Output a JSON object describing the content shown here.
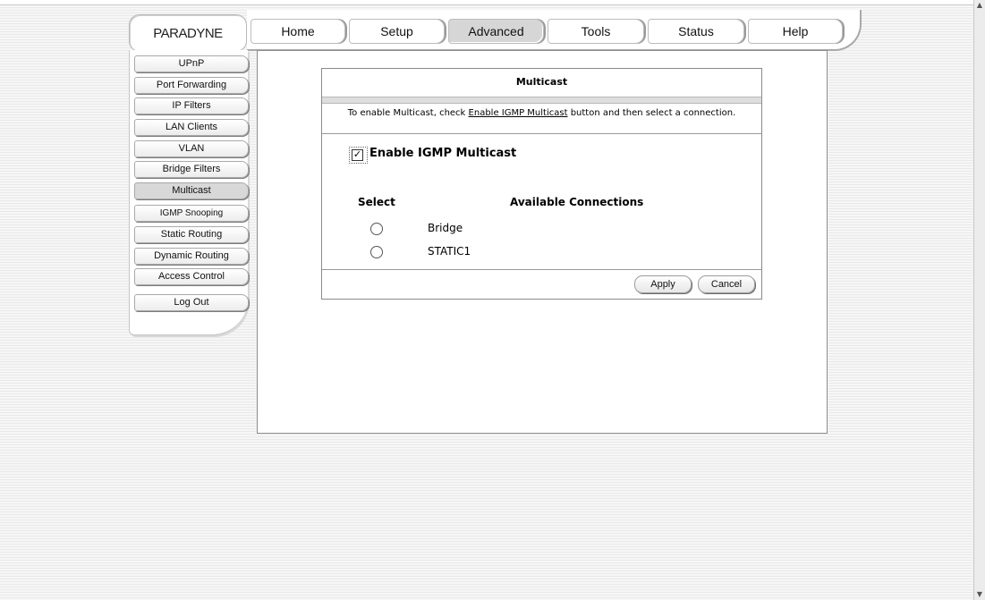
{
  "brand": {
    "logo": "PARADYNE"
  },
  "nav": {
    "tabs": [
      {
        "label": "Home"
      },
      {
        "label": "Setup"
      },
      {
        "label": "Advanced"
      },
      {
        "label": "Tools"
      },
      {
        "label": "Status"
      },
      {
        "label": "Help"
      }
    ],
    "active": "Advanced"
  },
  "sidebar": {
    "items": [
      {
        "label": "UPnP"
      },
      {
        "label": "Port Forwarding"
      },
      {
        "label": "IP Filters"
      },
      {
        "label": "LAN Clients"
      },
      {
        "label": "VLAN"
      },
      {
        "label": "Bridge Filters"
      },
      {
        "label": "Multicast"
      },
      {
        "label": "IGMP Snooping"
      },
      {
        "label": "Static Routing"
      },
      {
        "label": "Dynamic Routing"
      },
      {
        "label": "Access Control"
      },
      {
        "label": "Log Out"
      }
    ],
    "active": "Multicast"
  },
  "multicast": {
    "title": "Multicast",
    "instruction_pre": "To enable Multicast, check ",
    "instruction_link": "Enable IGMP Multicast",
    "instruction_post": " button and then select a connection.",
    "enable_label": "Enable IGMP Multicast",
    "enable_checked": true,
    "checkbox_mark": "✓",
    "col_select": "Select",
    "col_connections": "Available Connections",
    "connections": [
      {
        "name": "Bridge",
        "selected": false
      },
      {
        "name": "STATIC1",
        "selected": false
      }
    ],
    "apply_label": "Apply",
    "cancel_label": "Cancel"
  },
  "colors": {
    "active_tab": "#d6d6d6",
    "panel_border": "#8e8e8e"
  },
  "icons": {
    "scroll_up": "scroll-up-arrow-icon",
    "scroll_down": "scroll-down-arrow-icon"
  }
}
